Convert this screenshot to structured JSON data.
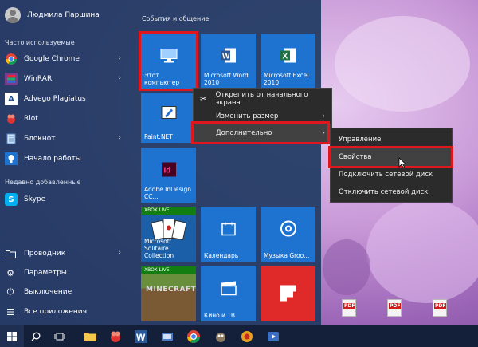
{
  "user": {
    "name": "Людмила Паршина"
  },
  "left": {
    "frequent_label": "Часто используемые",
    "frequent": [
      {
        "label": "Google Chrome",
        "icon": "chrome-icon",
        "has_arrow": true
      },
      {
        "label": "WinRAR",
        "icon": "winrar-icon",
        "has_arrow": true
      },
      {
        "label": "Advego Plagiatus",
        "icon": "advego-icon",
        "has_arrow": false
      },
      {
        "label": "Riot",
        "icon": "riot-icon",
        "has_arrow": false
      },
      {
        "label": "Блокнот",
        "icon": "notepad-icon",
        "has_arrow": true
      },
      {
        "label": "Начало работы",
        "icon": "lightbulb-icon",
        "has_arrow": false
      }
    ],
    "recent_label": "Недавно добавленные",
    "recent": [
      {
        "label": "Skype",
        "icon": "skype-icon"
      }
    ],
    "system": [
      {
        "label": "Проводник",
        "icon": "folder-icon",
        "has_arrow": true
      },
      {
        "label": "Параметры",
        "icon": "gear-icon",
        "has_arrow": false
      },
      {
        "label": "Выключение",
        "icon": "power-icon",
        "has_arrow": false
      },
      {
        "label": "Все приложения",
        "icon": "list-icon",
        "has_arrow": false
      }
    ]
  },
  "tiles": {
    "group_title": "События и общение",
    "this_pc": "Этот компьютер",
    "word": "Microsoft Word 2010",
    "excel": "Microsoft Excel 2010",
    "paintnet": "Paint.NET",
    "indesign": "Adobe InDesign CC...",
    "solitaire": "Microsoft Solitaire Collection",
    "calendar": "Календарь",
    "music": "Музыка Groo...",
    "movies": "Кино и ТВ",
    "xbox_badge": "XBOX LIVE",
    "minecraft_logo": "MINECRAFT"
  },
  "context_menu": {
    "items": [
      {
        "label": "Открепить от начального экрана",
        "icon": "unpin-icon",
        "arrow": false
      },
      {
        "label": "Изменить размер",
        "arrow": true
      },
      {
        "label": "Дополнительно",
        "arrow": true,
        "selected": true
      }
    ]
  },
  "submenu": {
    "items": [
      {
        "label": "Управление"
      },
      {
        "label": "Свойства",
        "selected": true
      },
      {
        "label": "Подключить сетевой диск"
      },
      {
        "label": "Отключить сетевой диск"
      }
    ]
  },
  "colors": {
    "tile_blue": "#1e73d0",
    "highlight_red": "#e0161e",
    "menu_bg": "#2b2b2b",
    "xbox_green": "#127d10"
  }
}
